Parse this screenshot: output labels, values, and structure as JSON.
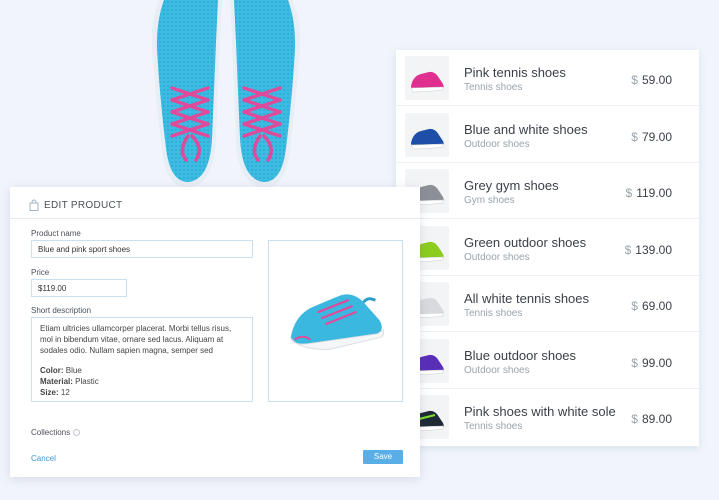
{
  "edit_product": {
    "title": "EDIT PRODUCT",
    "product_name_label": "Product name",
    "product_name_value": "Blue and pink sport shoes",
    "price_label": "Price",
    "price_value": "$119.00",
    "description_label": "Short description",
    "description_text": "Etiam ultricies ullamcorper placerat. Morbi tellus risus, mol in bibendum vitae, ornare sed lacus. Aliquam at sodales odio. Nullam sapien magna, semper sed",
    "color_key": "Color:",
    "color_value": "Blue",
    "material_key": "Material:",
    "material_value": "Plastic",
    "size_key": "Size:",
    "size_value": "12",
    "collections_label": "Collections",
    "cancel_label": "Cancel",
    "save_label": "Save"
  },
  "product_list": {
    "currency_symbol": "$",
    "items": [
      {
        "name": "Pink tennis shoes",
        "category": "Tennis shoes",
        "price": "59.00",
        "color": "#e0308f"
      },
      {
        "name": "Blue and white shoes",
        "category": "Outdoor shoes",
        "price": "79.00",
        "color": "#1d4fa8"
      },
      {
        "name": "Grey gym shoes",
        "category": "Gym shoes",
        "price": "119.00",
        "color": "#8c9096"
      },
      {
        "name": "Green outdoor shoes",
        "category": "Outdoor shoes",
        "price": "139.00",
        "color": "#8ccc1e"
      },
      {
        "name": "All white tennis shoes",
        "category": "Tennis shoes",
        "price": "69.00",
        "color": "#d8dadd"
      },
      {
        "name": "Blue outdoor shoes",
        "category": "Outdoor shoes",
        "price": "99.00",
        "color": "#5a2fb8"
      },
      {
        "name": "Pink shoes with white sole",
        "category": "Tennis shoes",
        "price": "89.00",
        "color": "#1f2a36"
      }
    ]
  },
  "colors": {
    "accent": "#5aaee8",
    "field_border": "#c9e0f2",
    "shoe_blue": "#3bb8e0",
    "lace_pink": "#e04a9a"
  },
  "icons": {
    "header": "shopping-bag-icon",
    "collections_info": "info-icon"
  }
}
